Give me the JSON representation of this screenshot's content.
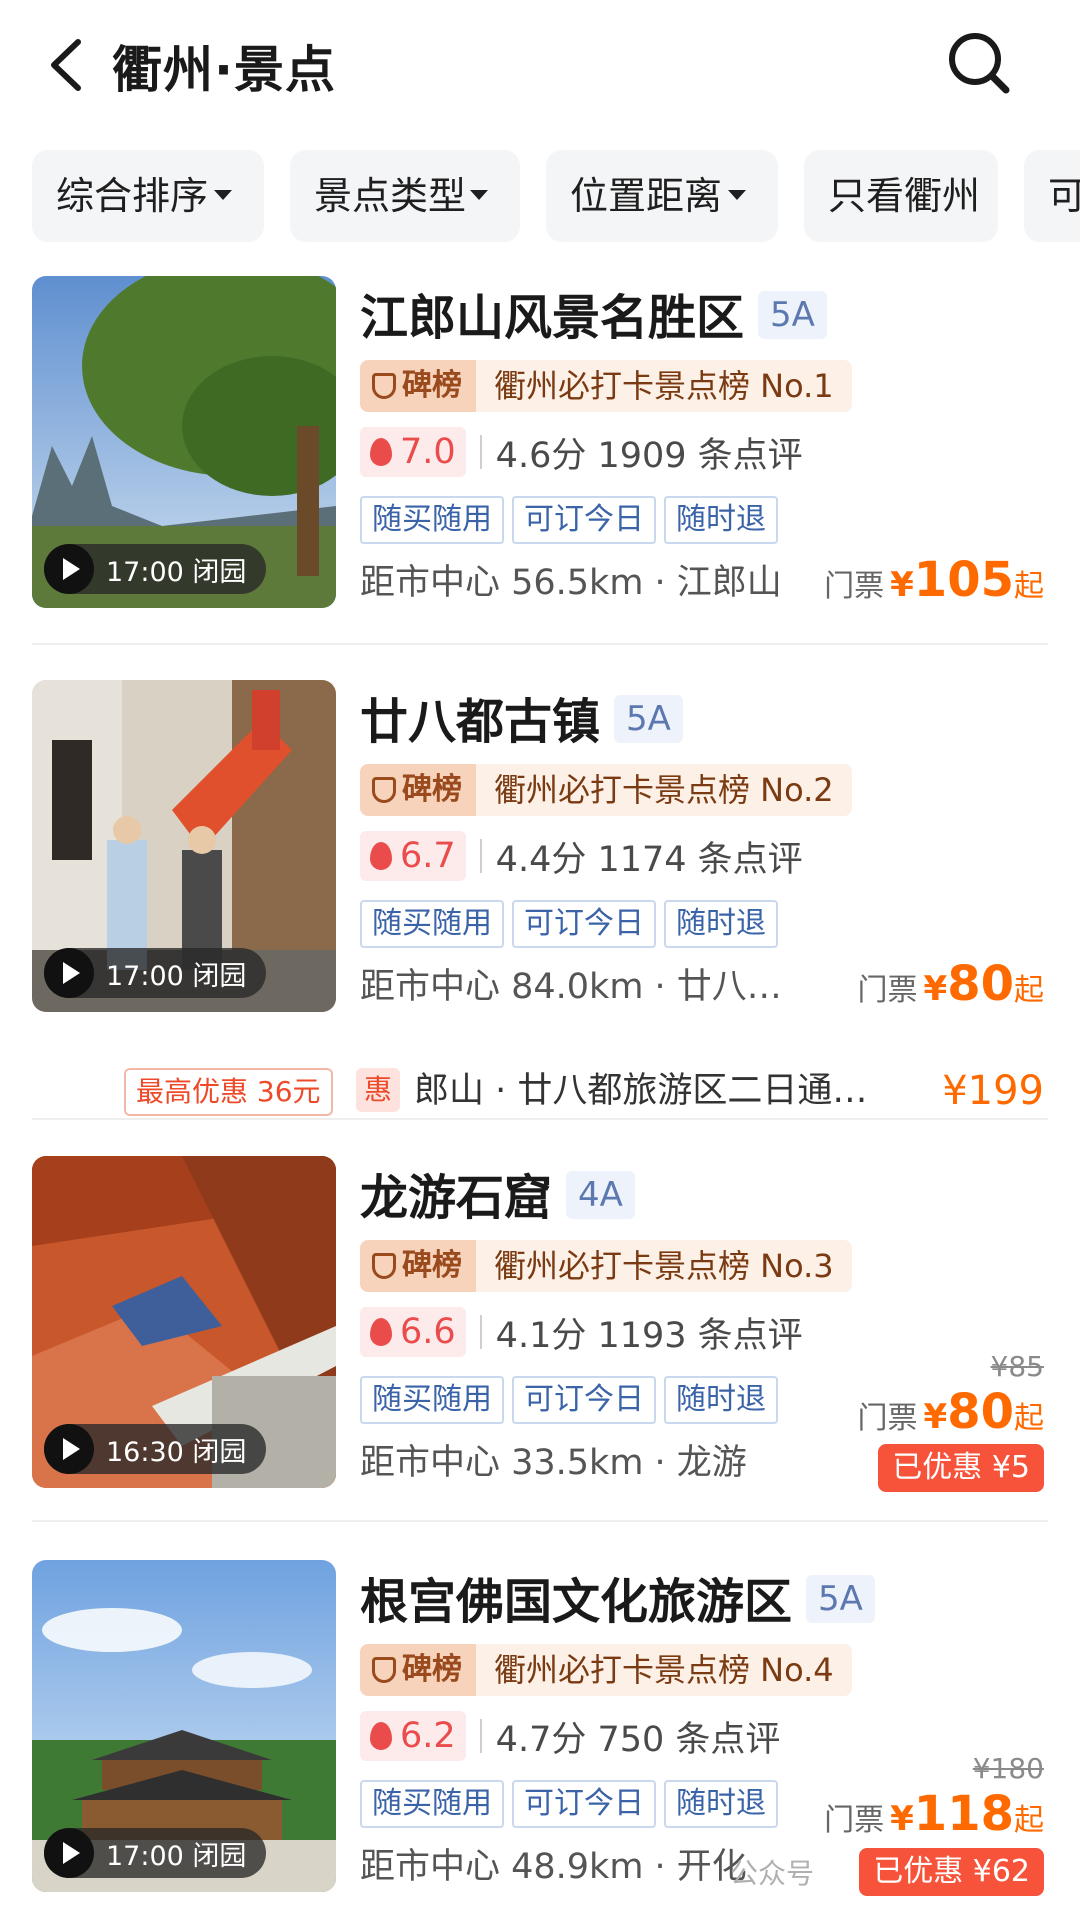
{
  "header": {
    "title": "衢州·景点"
  },
  "filters": [
    {
      "label": "综合排序",
      "has_caret": true
    },
    {
      "label": "景点类型",
      "has_caret": true
    },
    {
      "label": "位置距离",
      "has_caret": true
    },
    {
      "label": "只看衢州",
      "has_caret": false
    },
    {
      "label": "可",
      "has_caret": false
    }
  ],
  "listings": [
    {
      "name": "江郎山风景名胜区",
      "grade": "5A",
      "rank_badge": "碑榜",
      "rank_text": "衢州必打卡景点榜 No.1",
      "heat": "7.0",
      "score": "4.6分",
      "reviews": "1909 条点评",
      "tags": [
        "随买随用",
        "可订今日",
        "随时退"
      ],
      "distance": "距市中心 56.5km · 江郎山",
      "close_time": "17:00 闭园",
      "price_label": "门票",
      "currency": "¥",
      "price": "105",
      "price_suffix": "起"
    },
    {
      "name": "廿八都古镇",
      "grade": "5A",
      "rank_badge": "碑榜",
      "rank_text": "衢州必打卡景点榜 No.2",
      "heat": "6.7",
      "score": "4.4分",
      "reviews": "1174 条点评",
      "tags": [
        "随买随用",
        "可订今日",
        "随时退"
      ],
      "distance": "距市中心 84.0km · 廿八…",
      "close_time": "17:00 闭园",
      "price_label": "门票",
      "currency": "¥",
      "price": "80",
      "price_suffix": "起",
      "promo": {
        "max_discount": "最高优惠 36元",
        "badge": "惠",
        "package": "郎山 · 廿八都旅游区二日通…",
        "package_price": "¥199"
      }
    },
    {
      "name": "龙游石窟",
      "grade": "4A",
      "rank_badge": "碑榜",
      "rank_text": "衢州必打卡景点榜 No.3",
      "heat": "6.6",
      "score": "4.1分",
      "reviews": "1193 条点评",
      "tags": [
        "随买随用",
        "可订今日",
        "随时退"
      ],
      "distance": "距市中心 33.5km · 龙游",
      "close_time": "16:30 闭园",
      "original_price": "¥85",
      "price_label": "门票",
      "currency": "¥",
      "price": "80",
      "price_suffix": "起",
      "saved": "已优惠 ¥5"
    },
    {
      "name": "根宫佛国文化旅游区",
      "grade": "5A",
      "rank_badge": "碑榜",
      "rank_text": "衢州必打卡景点榜 No.4",
      "heat": "6.2",
      "score": "4.7分",
      "reviews": "750 条点评",
      "tags": [
        "随买随用",
        "可订今日",
        "随时退"
      ],
      "distance": "距市中心 48.9km · 开化",
      "close_time": "17:00 闭园",
      "original_price": "¥180",
      "price_label": "门票",
      "currency": "¥",
      "price": "118",
      "price_suffix": "起",
      "saved": "已优惠 ¥62"
    }
  ],
  "watermark": "公众号"
}
